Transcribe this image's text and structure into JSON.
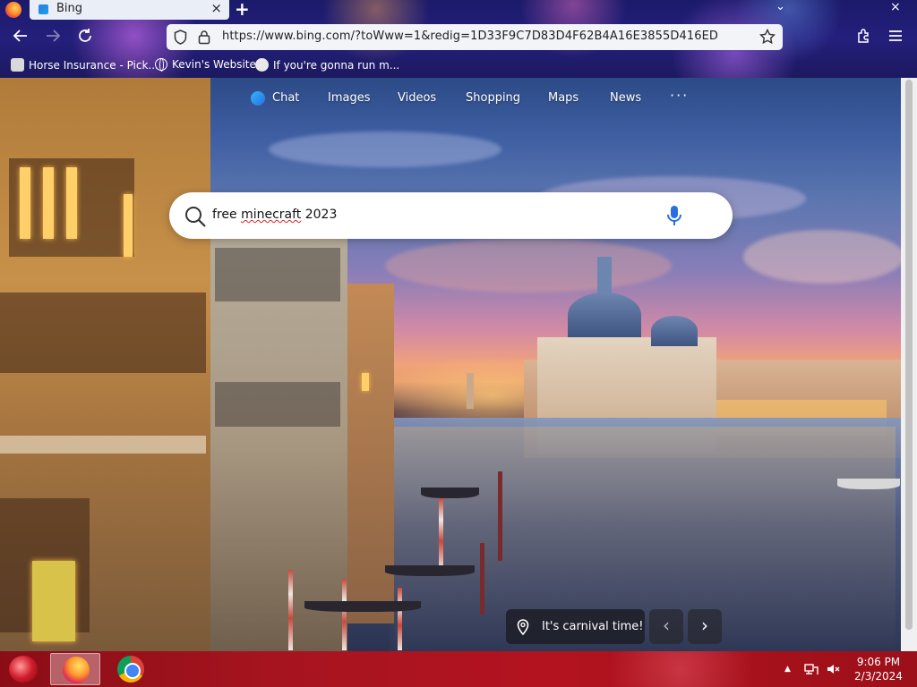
{
  "browser": {
    "tab": {
      "title": "Bing",
      "close": "×"
    },
    "new_tab": "+",
    "tab_list": "⌄",
    "window_close": "×",
    "url": "https://www.bing.com/?toWww=1&redig=1D33F9C7D83D4F62B4A16E3855D416ED",
    "bookmarks": [
      {
        "label": "Horse Insurance - Pick...",
        "icon": "bookmark-favicon"
      },
      {
        "label": "Kevin's Website",
        "icon": "globe-icon"
      },
      {
        "label": "If you're gonna run m...",
        "icon": "mask-icon"
      }
    ]
  },
  "bing": {
    "nav": {
      "chat": "Chat",
      "images": "Images",
      "videos": "Videos",
      "shopping": "Shopping",
      "maps": "Maps",
      "news": "News",
      "more": "···"
    },
    "search": {
      "before": "free ",
      "misspelled": "minecraft",
      "after": " 2023"
    },
    "carnival": "It's carnival time!",
    "prev": "‹",
    "next": "›"
  },
  "taskbar": {
    "tray_chevron": "▲",
    "time": "9:06 PM",
    "date": "2/3/2024"
  },
  "colors": {
    "taskbar": "#a6141f",
    "urlbar": "#f3f4f8",
    "bing_mic": "#2a6fe0"
  }
}
